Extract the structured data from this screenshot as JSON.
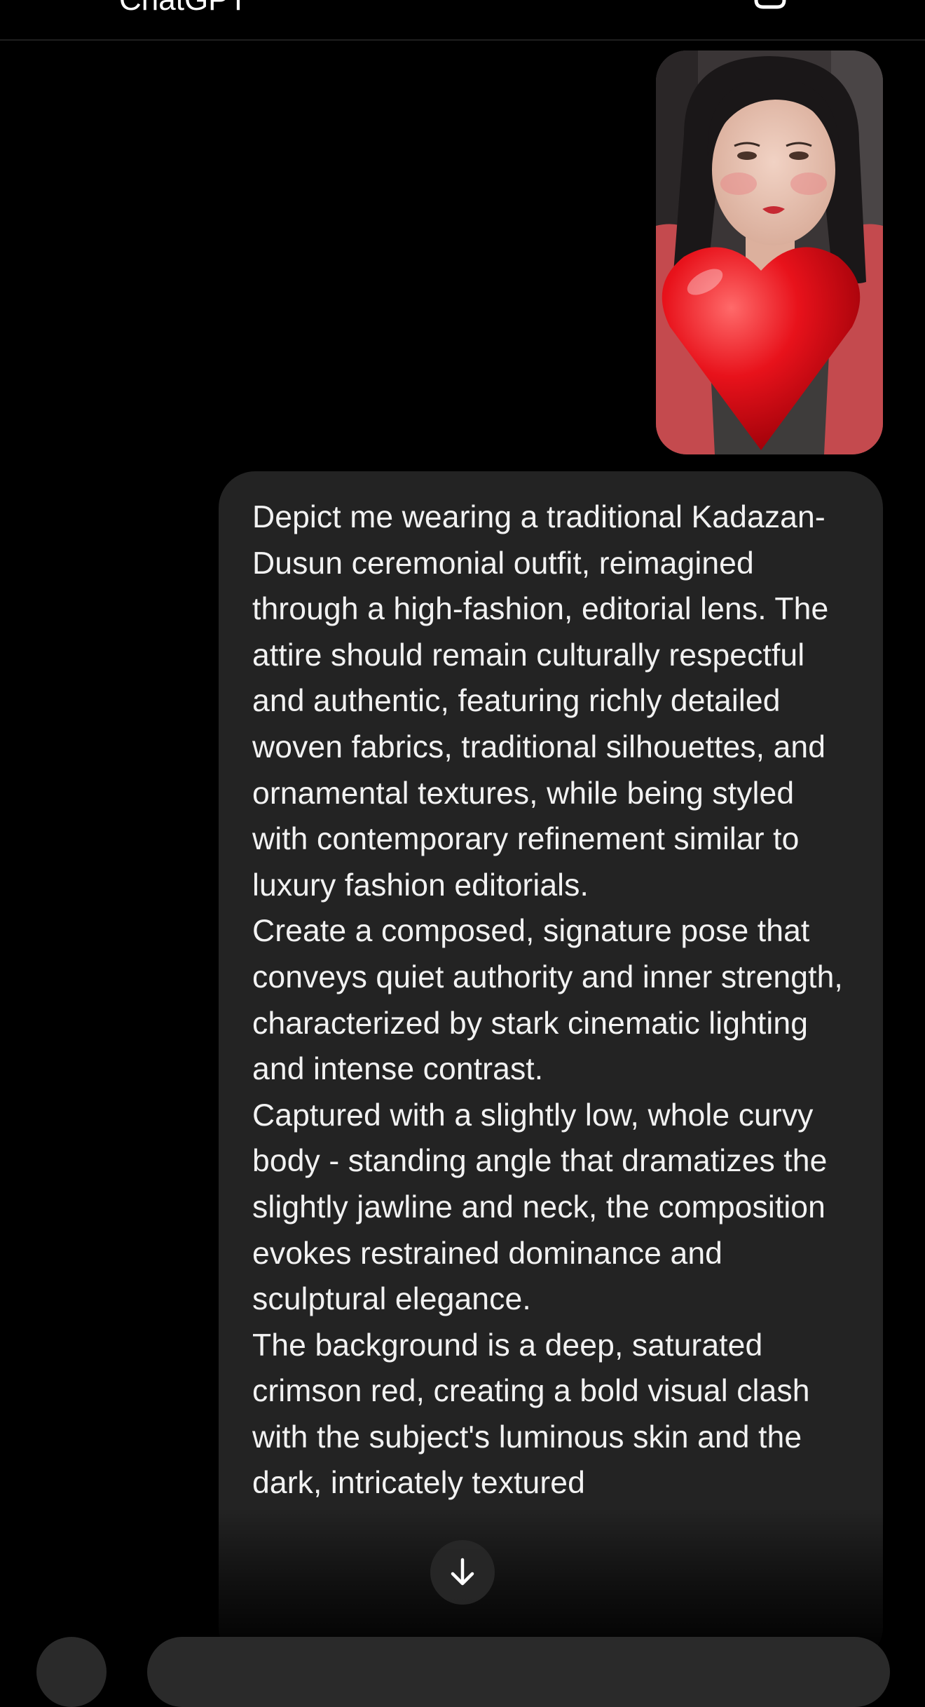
{
  "header": {
    "title": "ChatGPT"
  },
  "message": {
    "paragraphs": [
      "Depict me wearing a traditional Kadazan-Dusun ceremonial outfit, reimagined through a high-fashion, editorial lens. The attire should remain culturally respectful and authentic, featuring richly detailed woven fabrics, traditional silhouettes, and ornamental textures, while being styled with contemporary refinement similar to luxury fashion editorials.",
      "Create a composed, signature pose that conveys quiet authority and inner strength, characterized by stark cinematic lighting and intense contrast.",
      "Captured with a slightly low, whole curvy body - standing angle that dramatizes the slightly jawline and neck, the composition evokes restrained dominance and sculptural elegance.",
      "The background is a deep, saturated crimson red, creating a bold visual clash with the subject's luminous skin and the dark, intricately textured"
    ]
  },
  "colors": {
    "background": "#000000",
    "bubble": "#232323",
    "text": "#f2f2f2"
  }
}
